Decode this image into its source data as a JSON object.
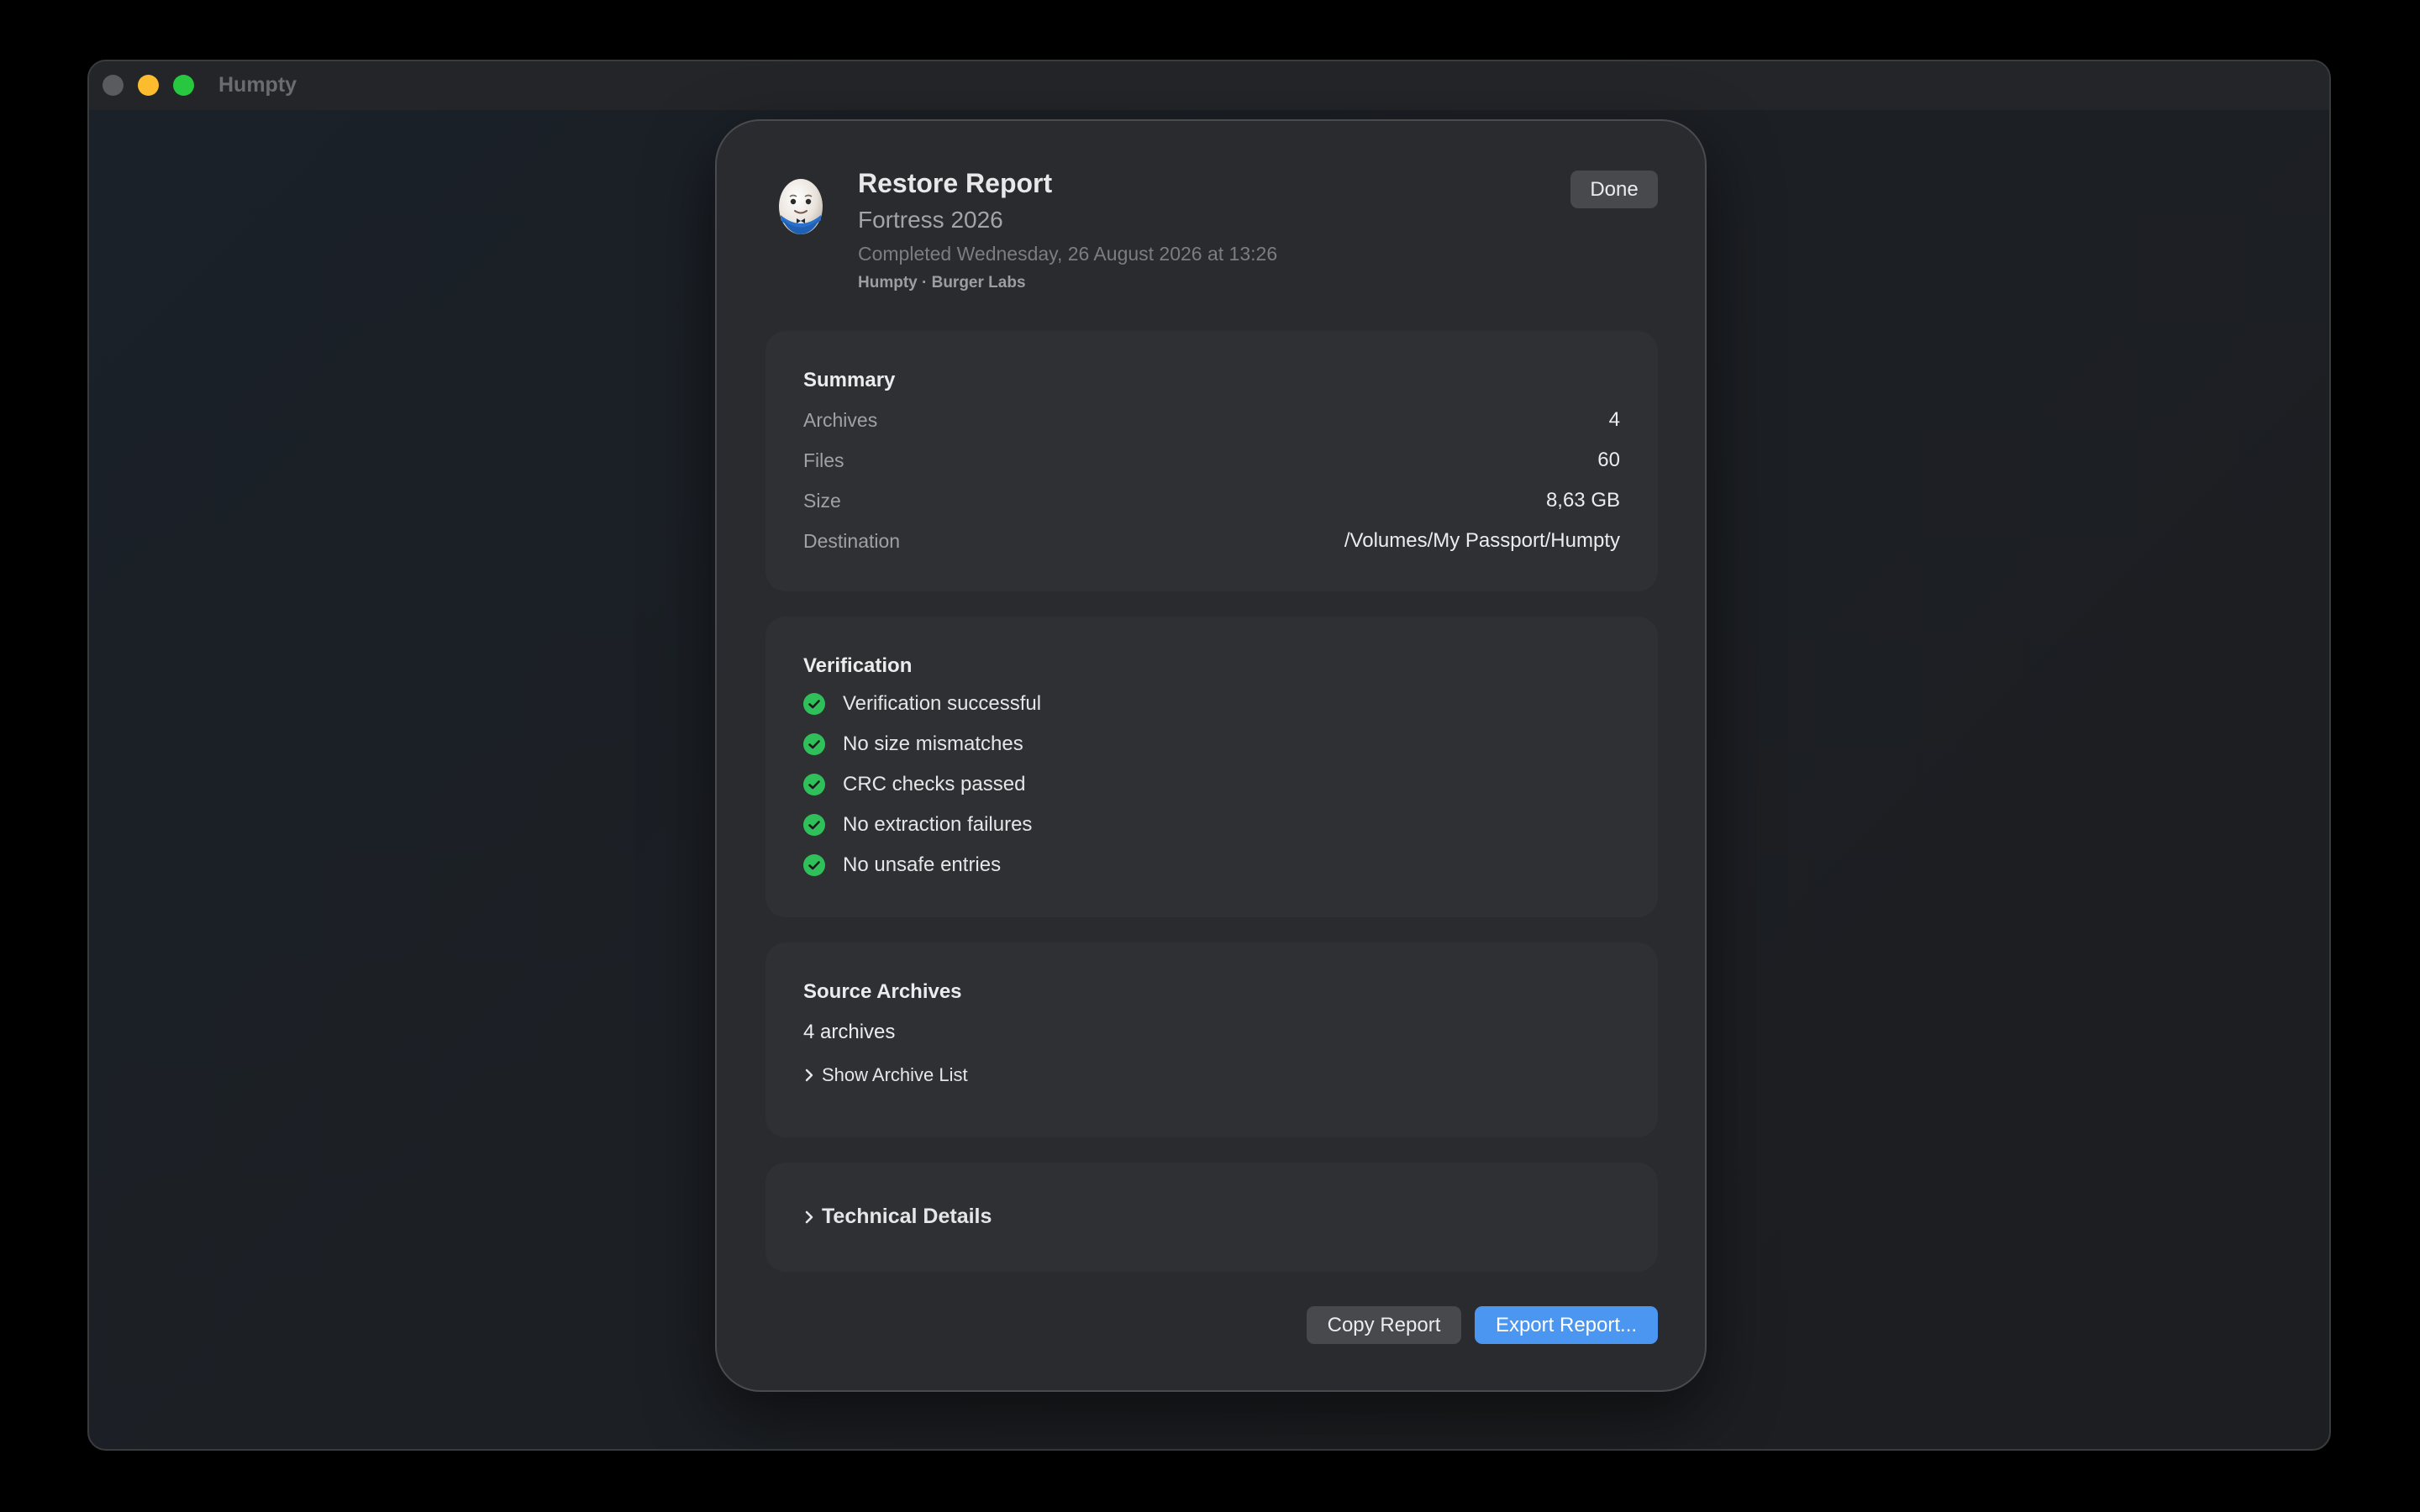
{
  "window": {
    "title": "Humpty"
  },
  "header": {
    "title": "Restore Report",
    "subtitle": "Fortress 2026",
    "completed": "Completed Wednesday, 26 August 2026 at 13:26",
    "vendor": "Humpty · Burger Labs",
    "done_label": "Done",
    "app_icon": "humpty-egg-icon"
  },
  "summary": {
    "title": "Summary",
    "rows": [
      {
        "label": "Archives",
        "value": "4"
      },
      {
        "label": "Files",
        "value": "60"
      },
      {
        "label": "Size",
        "value": "8,63 GB"
      },
      {
        "label": "Destination",
        "value": "/Volumes/My Passport/Humpty"
      }
    ]
  },
  "verification": {
    "title": "Verification",
    "checks": [
      {
        "label": "Verification successful",
        "status": "passed"
      },
      {
        "label": "No size mismatches",
        "status": "passed"
      },
      {
        "label": "CRC checks passed",
        "status": "passed"
      },
      {
        "label": "No extraction failures",
        "status": "passed"
      },
      {
        "label": "No unsafe entries",
        "status": "passed"
      }
    ]
  },
  "source_archives": {
    "title": "Source Archives",
    "count_text": "4 archives",
    "toggle_label": "Show Archive List"
  },
  "technical_details": {
    "toggle_label": "Technical Details"
  },
  "footer": {
    "copy_label": "Copy Report",
    "export_label": "Export Report..."
  },
  "colors": {
    "accent": "#4b96f0",
    "success": "#30c05a",
    "traffic_close": "#5a5b5e",
    "traffic_min": "#fdbc2e",
    "traffic_max": "#27c840"
  }
}
